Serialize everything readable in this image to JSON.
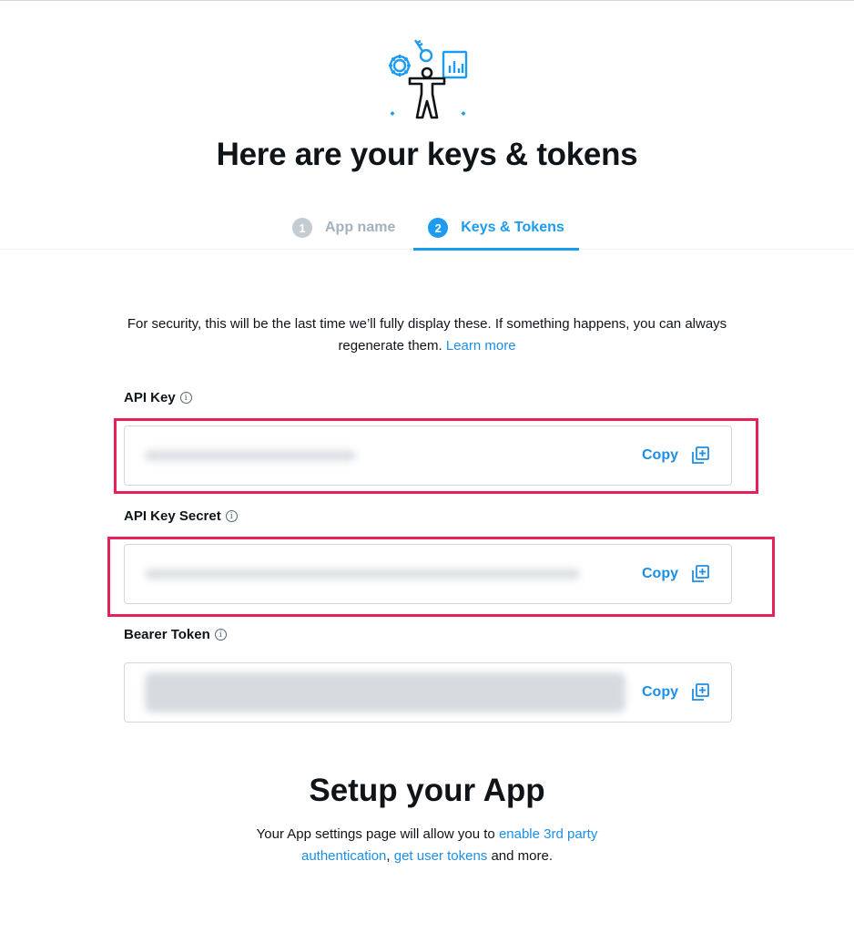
{
  "colors": {
    "accent": "#1d9bf0",
    "link": "#1d8ee6",
    "highlight": "#e8205a",
    "step_inactive": "#a5b2bd"
  },
  "header": {
    "illustration_icon": "developer-keys-illustration",
    "title": "Here are your keys & tokens"
  },
  "stepper": {
    "steps": [
      {
        "number": "1",
        "label": "App name",
        "active": false
      },
      {
        "number": "2",
        "label": "Keys & Tokens",
        "active": true
      }
    ]
  },
  "notice": {
    "text": "For security, this will be the last time we’ll fully display these. If something happens, you can always regenerate them. ",
    "link": "Learn more"
  },
  "fields": [
    {
      "label": "API Key",
      "info_icon": "info-icon",
      "copy_label": "Copy",
      "copy_icon": "copy-add-icon",
      "highlighted": true
    },
    {
      "label": "API Key Secret",
      "info_icon": "info-icon",
      "copy_label": "Copy",
      "copy_icon": "copy-add-icon",
      "highlighted": true
    },
    {
      "label": "Bearer Token",
      "info_icon": "info-icon",
      "copy_label": "Copy",
      "copy_icon": "copy-add-icon",
      "highlighted": false
    }
  ],
  "setup": {
    "title": "Setup your App",
    "text_before": "Your App settings page will allow you to ",
    "link_1": "enable 3rd party authentication",
    "separator": ", ",
    "link_2": "get user tokens",
    "text_after": " and more."
  }
}
